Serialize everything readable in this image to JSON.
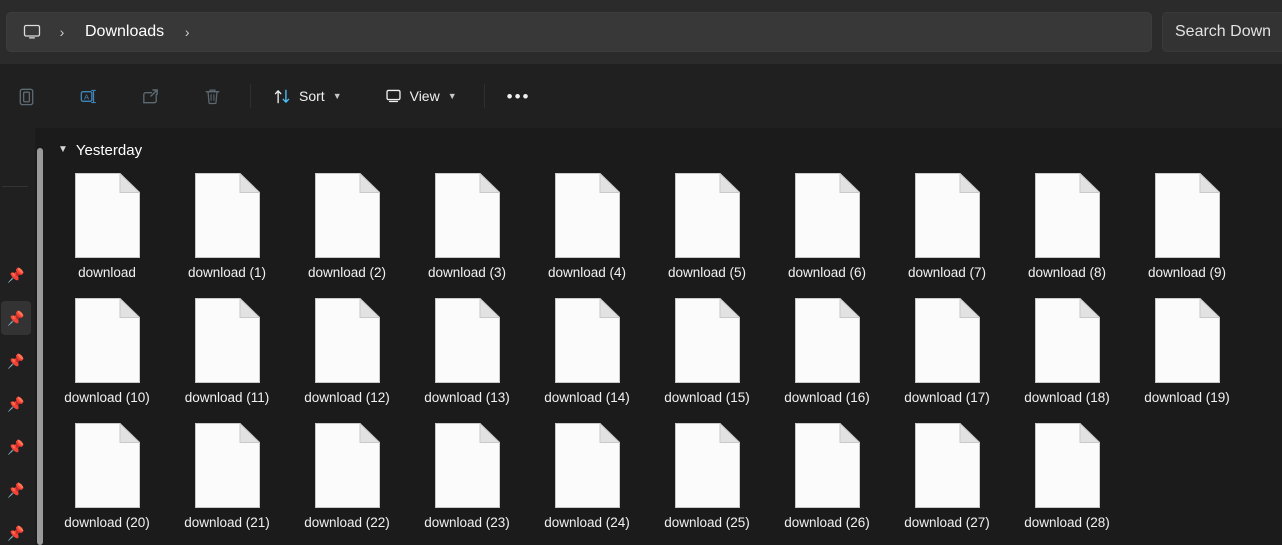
{
  "window": {
    "background": "#1b1b1b",
    "accent": "#4cc2ff"
  },
  "addressbar": {
    "home_icon": "monitor-icon",
    "separator": "›",
    "crumbs": [
      "Downloads"
    ],
    "trailing_separator": "›"
  },
  "search": {
    "placeholder": "Search Down",
    "value": ""
  },
  "toolbar": {
    "items": [
      {
        "name": "paste-button",
        "icon": "clipboard-paste-icon",
        "label": "",
        "chevron": false,
        "disabled": true
      },
      {
        "name": "rename-button",
        "icon": "rename-icon",
        "label": "",
        "chevron": false,
        "disabled": true
      },
      {
        "name": "share-button",
        "icon": "share-icon",
        "label": "",
        "chevron": false,
        "disabled": true
      },
      {
        "name": "delete-button",
        "icon": "trash-icon",
        "label": "",
        "chevron": false,
        "disabled": true
      }
    ],
    "sort": {
      "label": "Sort",
      "icon": "sort-arrows-icon",
      "chevron": "⌄"
    },
    "view": {
      "label": "View",
      "icon": "view-monitor-icon",
      "chevron": "⌄"
    },
    "more": {
      "label": "•••",
      "name": "see-more-button"
    }
  },
  "nav_rail": {
    "items": [
      {
        "icon": "pin-icon",
        "selected": false
      },
      {
        "icon": "pin-icon",
        "selected": true
      },
      {
        "icon": "pin-icon",
        "selected": false
      },
      {
        "icon": "pin-icon",
        "selected": false
      },
      {
        "icon": "pin-icon",
        "selected": false
      },
      {
        "icon": "pin-icon",
        "selected": false
      },
      {
        "icon": "pin-icon",
        "selected": false
      }
    ]
  },
  "content": {
    "group": {
      "chevron": "⌄",
      "title": "Yesterday"
    },
    "files": [
      {
        "name": "download",
        "icon": "document-icon"
      },
      {
        "name": "download (1)",
        "icon": "document-icon"
      },
      {
        "name": "download (2)",
        "icon": "document-icon"
      },
      {
        "name": "download (3)",
        "icon": "document-icon"
      },
      {
        "name": "download (4)",
        "icon": "document-icon"
      },
      {
        "name": "download (5)",
        "icon": "document-icon"
      },
      {
        "name": "download (6)",
        "icon": "document-icon"
      },
      {
        "name": "download (7)",
        "icon": "document-icon"
      },
      {
        "name": "download (8)",
        "icon": "document-icon"
      },
      {
        "name": "download (9)",
        "icon": "document-icon"
      },
      {
        "name": "download (10)",
        "icon": "document-icon"
      },
      {
        "name": "download (11)",
        "icon": "document-icon"
      },
      {
        "name": "download (12)",
        "icon": "document-icon"
      },
      {
        "name": "download (13)",
        "icon": "document-icon"
      },
      {
        "name": "download (14)",
        "icon": "document-icon"
      },
      {
        "name": "download (15)",
        "icon": "document-icon"
      },
      {
        "name": "download (16)",
        "icon": "document-icon"
      },
      {
        "name": "download (17)",
        "icon": "document-icon"
      },
      {
        "name": "download (18)",
        "icon": "document-icon"
      },
      {
        "name": "download (19)",
        "icon": "document-icon"
      },
      {
        "name": "download (20)",
        "icon": "document-icon"
      },
      {
        "name": "download (21)",
        "icon": "document-icon"
      },
      {
        "name": "download (22)",
        "icon": "document-icon"
      },
      {
        "name": "download (23)",
        "icon": "document-icon"
      },
      {
        "name": "download (24)",
        "icon": "document-icon"
      },
      {
        "name": "download (25)",
        "icon": "document-icon"
      },
      {
        "name": "download (26)",
        "icon": "document-icon"
      },
      {
        "name": "download (27)",
        "icon": "document-icon"
      },
      {
        "name": "download (28)",
        "icon": "document-icon"
      }
    ]
  }
}
